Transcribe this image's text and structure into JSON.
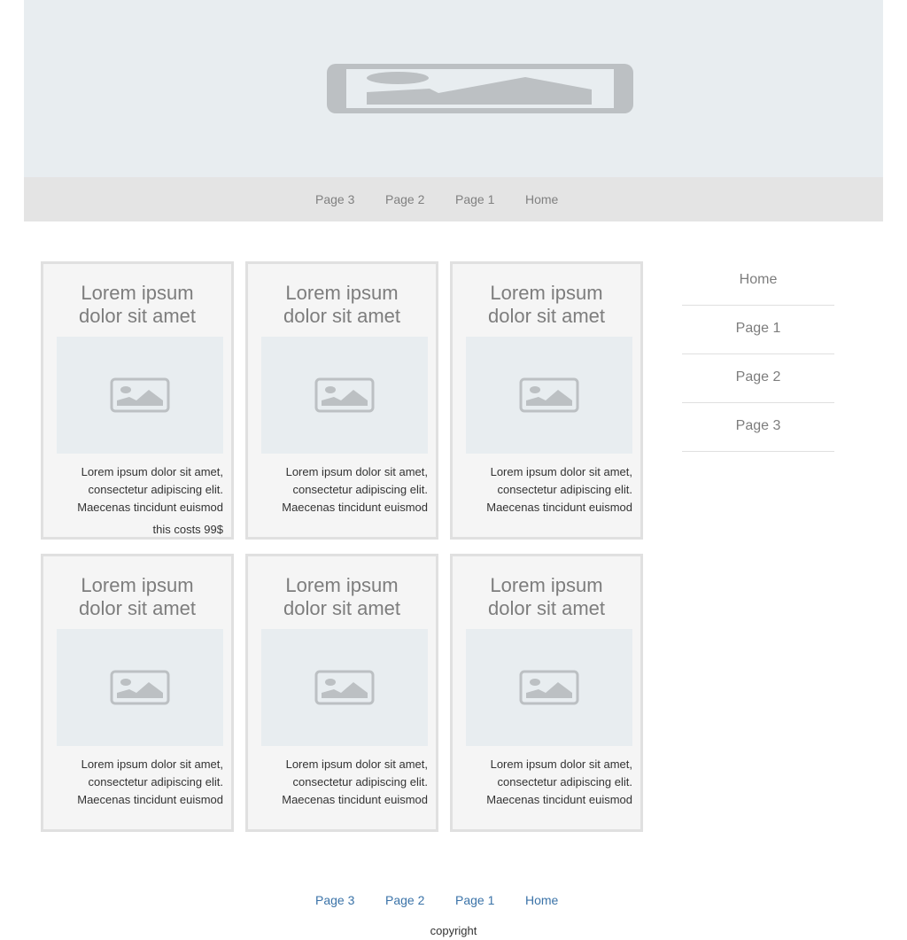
{
  "top_nav": {
    "items": [
      "Page 3",
      "Page 2",
      "Page 1",
      "Home"
    ]
  },
  "cards": [
    {
      "title_line1": "Lorem ipsum",
      "title_line2": "dolor sit amet",
      "desc": [
        "Lorem ipsum dolor sit amet,",
        "consectetur adipiscing elit.",
        "Maecenas tincidunt euismod"
      ],
      "price": "this costs 99$"
    },
    {
      "title_line1": "Lorem ipsum",
      "title_line2": "dolor sit amet",
      "desc": [
        "Lorem ipsum dolor sit amet,",
        "consectetur adipiscing elit.",
        "Maecenas tincidunt euismod"
      ]
    },
    {
      "title_line1": "Lorem ipsum",
      "title_line2": "dolor sit amet",
      "desc": [
        "Lorem ipsum dolor sit amet,",
        "consectetur adipiscing elit.",
        "Maecenas tincidunt euismod"
      ]
    },
    {
      "title_line1": "Lorem ipsum",
      "title_line2": "dolor sit amet",
      "desc": [
        "Lorem ipsum dolor sit amet,",
        "consectetur adipiscing elit.",
        "Maecenas tincidunt euismod"
      ]
    },
    {
      "title_line1": "Lorem ipsum",
      "title_line2": "dolor sit amet",
      "desc": [
        "Lorem ipsum dolor sit amet,",
        "consectetur adipiscing elit.",
        "Maecenas tincidunt euismod"
      ]
    },
    {
      "title_line1": "Lorem ipsum",
      "title_line2": "dolor sit amet",
      "desc": [
        "Lorem ipsum dolor sit amet,",
        "consectetur adipiscing elit.",
        "Maecenas tincidunt euismod"
      ]
    }
  ],
  "side_nav": {
    "items": [
      "Home",
      "Page 1",
      "Page 2",
      "Page 3"
    ]
  },
  "footer": {
    "nav": [
      "Page 3",
      "Page 2",
      "Page 1",
      "Home"
    ],
    "copyright": "copyright"
  },
  "icons": {
    "banner": "image-placeholder-icon",
    "card": "image-placeholder-icon"
  },
  "colors": {
    "link": "#3b73a8",
    "placeholder_bg": "#e8edf0",
    "nav_bg": "#e4e4e4"
  }
}
